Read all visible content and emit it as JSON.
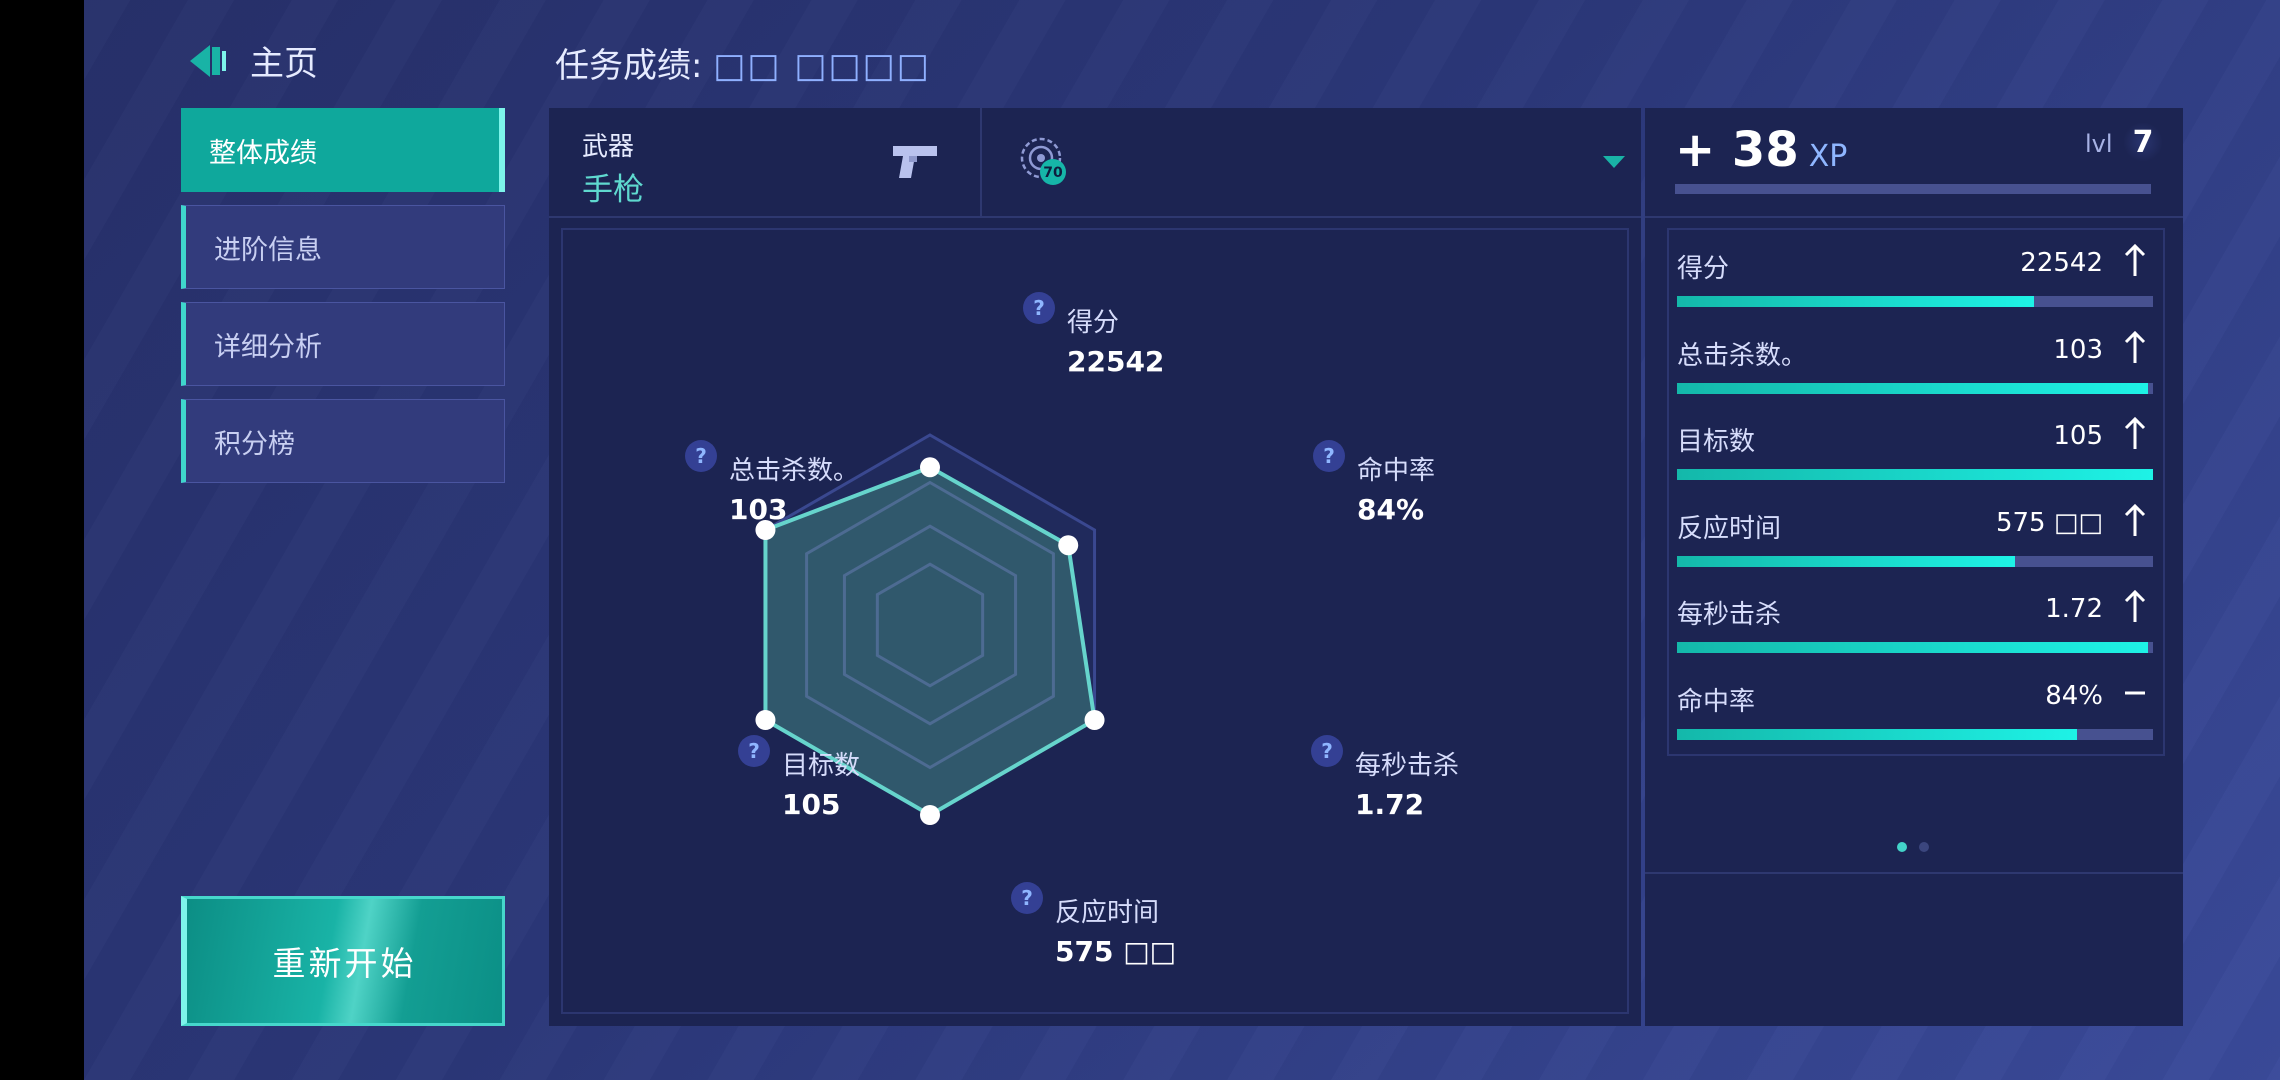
{
  "header": {
    "home_label": "主页",
    "mission_label": "任务成绩: ",
    "mission_sub": "□□ □□□□"
  },
  "nav": {
    "items": [
      {
        "label": "整体成绩"
      },
      {
        "label": "进阶信息"
      },
      {
        "label": "详细分析"
      },
      {
        "label": "积分榜"
      }
    ],
    "restart_label": "重新开始"
  },
  "weapon": {
    "caption": "武器",
    "value": "手枪",
    "badge": "70"
  },
  "radar": {
    "axes": [
      {
        "name": "得分",
        "value": "22542",
        "level": 0.83
      },
      {
        "name": "命中率",
        "value": "84%",
        "level": 0.84
      },
      {
        "name": "每秒击杀",
        "value": "1.72",
        "level": 1.0
      },
      {
        "name": "反应时间",
        "value": "575 □□",
        "level": 1.0
      },
      {
        "name": "目标数",
        "value": "105",
        "level": 1.0
      },
      {
        "name": "总击杀数。",
        "value": "103",
        "level": 1.0
      }
    ],
    "help_mark": "?",
    "colors": {
      "accent": "#66d4cc",
      "fill": "#34606f",
      "grid": "#3a4890"
    }
  },
  "xp": {
    "gain": "+ 38",
    "unit": "XP",
    "level_label": "lvl",
    "level": "7",
    "progress": 0
  },
  "stats": [
    {
      "name": "得分",
      "value": "22542",
      "trend": "up",
      "progress": 0.75
    },
    {
      "name": "总击杀数。",
      "value": "103",
      "trend": "up",
      "progress": 0.99
    },
    {
      "name": "目标数",
      "value": "105",
      "trend": "up",
      "progress": 1.0
    },
    {
      "name": "反应时间",
      "value": "575 □□",
      "trend": "up",
      "progress": 0.71
    },
    {
      "name": "每秒击杀",
      "value": "1.72",
      "trend": "up",
      "progress": 0.99
    },
    {
      "name": "命中率",
      "value": "84%",
      "trend": "flat",
      "progress": 0.84
    }
  ],
  "pagination": {
    "pages": 2,
    "current": 1
  }
}
